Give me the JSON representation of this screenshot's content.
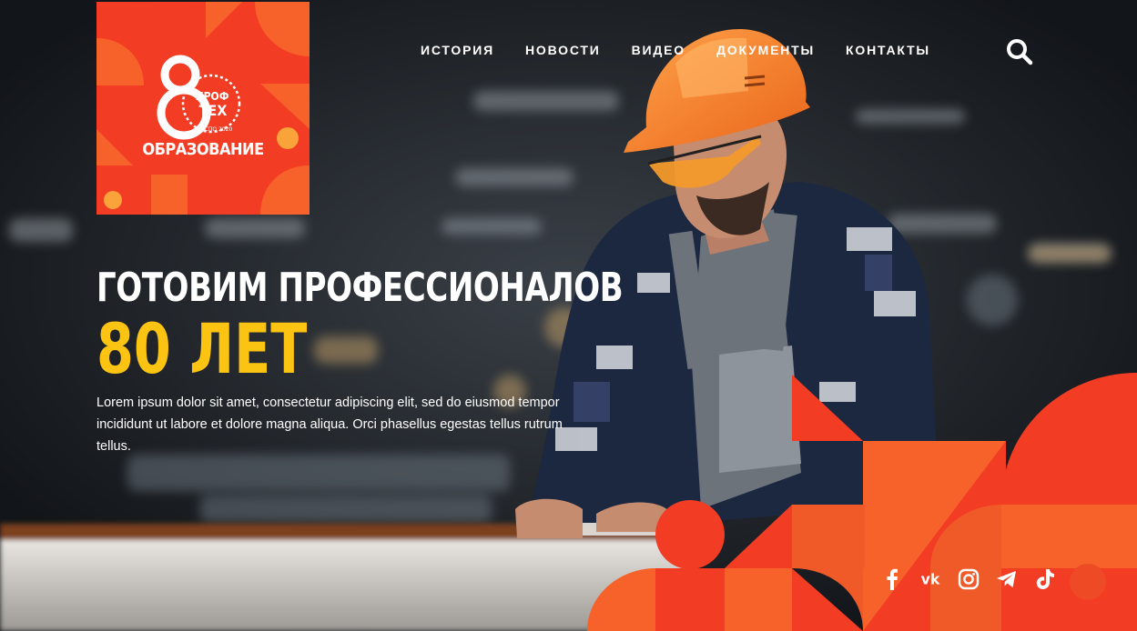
{
  "logo": {
    "big_digit": "8",
    "badge_line1": "ПРОФ",
    "badge_line2": "ТЕХ",
    "badge_ring": "СПО 2020",
    "caption": "ОБРАЗОВАНИЕ"
  },
  "nav": {
    "items": [
      "ИСТОРИЯ",
      "НОВОСТИ",
      "ВИДЕО",
      "ДОКУМЕНТЫ",
      "КОНТАКТЫ"
    ]
  },
  "hero": {
    "headline": "ГОТОВИМ ПРОФЕССИОНАЛОВ",
    "accent": "80 ЛЕТ",
    "lead": "Lorem ipsum dolor sit amet, consectetur adipiscing elit, sed do eiusmod tempor incididunt ut labore et dolore magna aliqua. Orci phasellus egestas tellus rutrum tellus."
  },
  "social": {
    "icons": [
      "facebook-icon",
      "vk-icon",
      "instagram-icon",
      "telegram-icon",
      "tiktok-icon"
    ],
    "vk_text": "vk"
  },
  "colors": {
    "brand_red": "#f23c24",
    "brand_orange": "#f7612a",
    "accent_yellow": "#fcc412",
    "text_white": "#ffffff",
    "background_dark": "#16191d"
  }
}
